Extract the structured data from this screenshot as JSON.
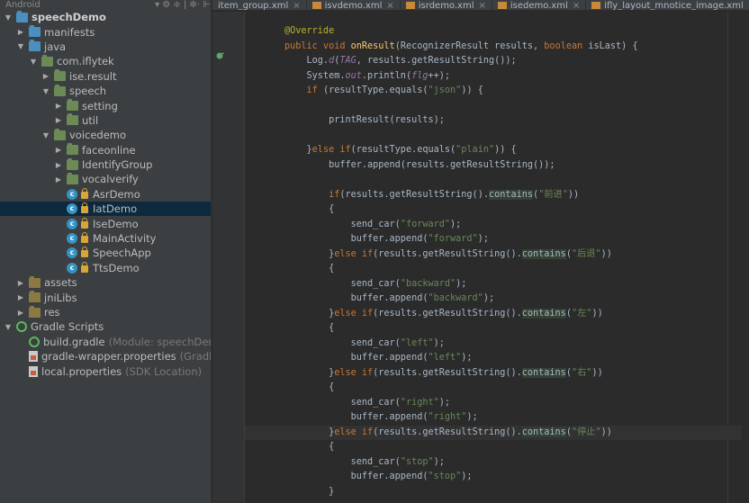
{
  "tree": {
    "header": {
      "title": "Android",
      "icons": "▾ ⚙ ≑ | ✲· ⊩"
    },
    "rows": [
      {
        "name": "tree-row-speechdemo",
        "depth": 0,
        "arrow": "▼",
        "icon": "module-folder",
        "label": "speechDemo",
        "bold": true
      },
      {
        "name": "tree-row-manifests",
        "depth": 1,
        "arrow": "▶",
        "icon": "folder",
        "label": "manifests"
      },
      {
        "name": "tree-row-java",
        "depth": 1,
        "arrow": "▼",
        "icon": "folder",
        "label": "java"
      },
      {
        "name": "tree-row-com-iflytek",
        "depth": 2,
        "arrow": "▼",
        "icon": "package",
        "label": "com.iflytek"
      },
      {
        "name": "tree-row-ise-result",
        "depth": 3,
        "arrow": "▶",
        "icon": "package",
        "label": "ise.result"
      },
      {
        "name": "tree-row-speech",
        "depth": 3,
        "arrow": "▼",
        "icon": "package",
        "label": "speech"
      },
      {
        "name": "tree-row-setting",
        "depth": 4,
        "arrow": "▶",
        "icon": "package",
        "label": "setting"
      },
      {
        "name": "tree-row-util",
        "depth": 4,
        "arrow": "▶",
        "icon": "package",
        "label": "util"
      },
      {
        "name": "tree-row-voicedemo",
        "depth": 3,
        "arrow": "▼",
        "icon": "package",
        "label": "voicedemo"
      },
      {
        "name": "tree-row-faceonline",
        "depth": 4,
        "arrow": "▶",
        "icon": "package",
        "label": "faceonline"
      },
      {
        "name": "tree-row-identifygroup",
        "depth": 4,
        "arrow": "▶",
        "icon": "package",
        "label": "IdentifyGroup"
      },
      {
        "name": "tree-row-vocalverify",
        "depth": 4,
        "arrow": "▶",
        "icon": "package",
        "label": "vocalverify"
      },
      {
        "name": "tree-row-asrdemo",
        "depth": 4,
        "arrow": "",
        "icon": "class",
        "label": "AsrDemo"
      },
      {
        "name": "tree-row-iatdemo",
        "depth": 4,
        "arrow": "",
        "icon": "class",
        "label": "IatDemo",
        "selected": true
      },
      {
        "name": "tree-row-isedemo",
        "depth": 4,
        "arrow": "",
        "icon": "class",
        "label": "IseDemo"
      },
      {
        "name": "tree-row-mainactivity",
        "depth": 4,
        "arrow": "",
        "icon": "class",
        "label": "MainActivity"
      },
      {
        "name": "tree-row-speechapp",
        "depth": 4,
        "arrow": "",
        "icon": "class",
        "label": "SpeechApp"
      },
      {
        "name": "tree-row-ttsdemo",
        "depth": 4,
        "arrow": "",
        "icon": "class",
        "label": "TtsDemo"
      },
      {
        "name": "tree-row-assets",
        "depth": 1,
        "arrow": "▶",
        "icon": "res-folder",
        "label": "assets"
      },
      {
        "name": "tree-row-jnilibs",
        "depth": 1,
        "arrow": "▶",
        "icon": "res-folder",
        "label": "jniLibs"
      },
      {
        "name": "tree-row-res",
        "depth": 1,
        "arrow": "▶",
        "icon": "res-folder",
        "label": "res"
      },
      {
        "name": "tree-row-gradle-scripts",
        "depth": 0,
        "arrow": "▼",
        "icon": "gradle",
        "label": "Gradle Scripts"
      },
      {
        "name": "tree-row-build-gradle",
        "depth": 1,
        "arrow": "",
        "icon": "gradle",
        "label": "build.gradle",
        "hint": "(Module: speechDemo"
      },
      {
        "name": "tree-row-gradle-wrapper",
        "depth": 1,
        "arrow": "",
        "icon": "properties",
        "label": "gradle-wrapper.properties",
        "hint": "(Gradle"
      },
      {
        "name": "tree-row-local-properties",
        "depth": 1,
        "arrow": "",
        "icon": "properties",
        "label": "local.properties",
        "hint": "(SDK Location)"
      }
    ]
  },
  "tabs": [
    {
      "name": "tab-item-group-xml",
      "label": "item_group.xml",
      "close": "×"
    },
    {
      "name": "tab-isvdemo-xml",
      "label": "isvdemo.xml",
      "close": "×"
    },
    {
      "name": "tab-isrdemo-xml",
      "label": "isrdemo.xml",
      "close": "×"
    },
    {
      "name": "tab-isedemo-xml",
      "label": "isedemo.xml",
      "close": "×"
    },
    {
      "name": "tab-ifly-layout-xml",
      "label": "ifly_layout_mnotice_image.xml",
      "close": "×"
    }
  ],
  "code": [
    [
      {
        "t": "@Override",
        "c": "an"
      }
    ],
    [
      {
        "t": "public void ",
        "c": "kw"
      },
      {
        "t": "onResult",
        "c": "fn"
      },
      {
        "t": "(RecognizerResult results, "
      },
      {
        "t": "boolean ",
        "c": "kw"
      },
      {
        "t": "isLast) {"
      }
    ],
    [
      {
        "t": "    Log."
      },
      {
        "t": "d",
        "c": "sf"
      },
      {
        "t": "("
      },
      {
        "t": "TAG",
        "c": "sf"
      },
      {
        "t": ", results.getResultString());"
      }
    ],
    [
      {
        "t": "    System."
      },
      {
        "t": "out",
        "c": "sf"
      },
      {
        "t": ".println("
      },
      {
        "t": "flg",
        "c": "sf"
      },
      {
        "t": "++);"
      }
    ],
    [
      {
        "t": "    "
      },
      {
        "t": "if ",
        "c": "kw"
      },
      {
        "t": "(resultType.equals("
      },
      {
        "t": "\"json\"",
        "c": "st"
      },
      {
        "t": ")) {"
      }
    ],
    [
      {
        "t": ""
      }
    ],
    [
      {
        "t": "        printResult(results);"
      }
    ],
    [
      {
        "t": ""
      }
    ],
    [
      {
        "t": "    }"
      },
      {
        "t": "else if",
        "c": "kw"
      },
      {
        "t": "(resultType.equals("
      },
      {
        "t": "\"plain\"",
        "c": "st"
      },
      {
        "t": ")) {"
      }
    ],
    [
      {
        "t": "        buffer.append(results.getResultString());"
      }
    ],
    [
      {
        "t": ""
      }
    ],
    [
      {
        "t": "        "
      },
      {
        "t": "if",
        "c": "kw"
      },
      {
        "t": "(results.getResultString()."
      },
      {
        "t": "contains",
        "c": "hl"
      },
      {
        "t": "("
      },
      {
        "t": "\"前进\"",
        "c": "st"
      },
      {
        "t": "))"
      }
    ],
    [
      {
        "t": "        {"
      }
    ],
    [
      {
        "t": "            send_car("
      },
      {
        "t": "\"forward\"",
        "c": "st"
      },
      {
        "t": ");"
      }
    ],
    [
      {
        "t": "            buffer.append("
      },
      {
        "t": "\"forward\"",
        "c": "st"
      },
      {
        "t": ");"
      }
    ],
    [
      {
        "t": "        }"
      },
      {
        "t": "else if",
        "c": "kw"
      },
      {
        "t": "(results.getResultString()."
      },
      {
        "t": "contains",
        "c": "hl"
      },
      {
        "t": "("
      },
      {
        "t": "\"后退\"",
        "c": "st"
      },
      {
        "t": "))"
      }
    ],
    [
      {
        "t": "        {"
      }
    ],
    [
      {
        "t": "            send_car("
      },
      {
        "t": "\"backward\"",
        "c": "st"
      },
      {
        "t": ");"
      }
    ],
    [
      {
        "t": "            buffer.append("
      },
      {
        "t": "\"backward\"",
        "c": "st"
      },
      {
        "t": ");"
      }
    ],
    [
      {
        "t": "        }"
      },
      {
        "t": "else if",
        "c": "kw"
      },
      {
        "t": "(results.getResultString()."
      },
      {
        "t": "contains",
        "c": "hl"
      },
      {
        "t": "("
      },
      {
        "t": "\"左\"",
        "c": "st"
      },
      {
        "t": "))"
      }
    ],
    [
      {
        "t": "        {"
      }
    ],
    [
      {
        "t": "            send_car("
      },
      {
        "t": "\"left\"",
        "c": "st"
      },
      {
        "t": ");"
      }
    ],
    [
      {
        "t": "            buffer.append("
      },
      {
        "t": "\"left\"",
        "c": "st"
      },
      {
        "t": ");"
      }
    ],
    [
      {
        "t": "        }"
      },
      {
        "t": "else if",
        "c": "kw"
      },
      {
        "t": "(results.getResultString()."
      },
      {
        "t": "contains",
        "c": "hl"
      },
      {
        "t": "("
      },
      {
        "t": "\"右\"",
        "c": "st"
      },
      {
        "t": "))"
      }
    ],
    [
      {
        "t": "        {"
      }
    ],
    [
      {
        "t": "            send_car("
      },
      {
        "t": "\"right\"",
        "c": "st"
      },
      {
        "t": ");"
      }
    ],
    [
      {
        "t": "            buffer.append("
      },
      {
        "t": "\"right\"",
        "c": "st"
      },
      {
        "t": ");"
      }
    ],
    [
      {
        "t": "        }"
      },
      {
        "t": "else if",
        "c": "kw"
      },
      {
        "t": "(results.getResultString()."
      },
      {
        "t": "contains",
        "c": "hl"
      },
      {
        "t": "("
      },
      {
        "t": "\"停止\"",
        "c": "st"
      },
      {
        "t": "))"
      }
    ],
    [
      {
        "t": "        {"
      }
    ],
    [
      {
        "t": "            send_car("
      },
      {
        "t": "\"stop\"",
        "c": "st"
      },
      {
        "t": ");"
      }
    ],
    [
      {
        "t": "            buffer.append("
      },
      {
        "t": "\"stop\"",
        "c": "st"
      },
      {
        "t": ");"
      }
    ],
    [
      {
        "t": "        }"
      }
    ]
  ],
  "current_line": 27
}
